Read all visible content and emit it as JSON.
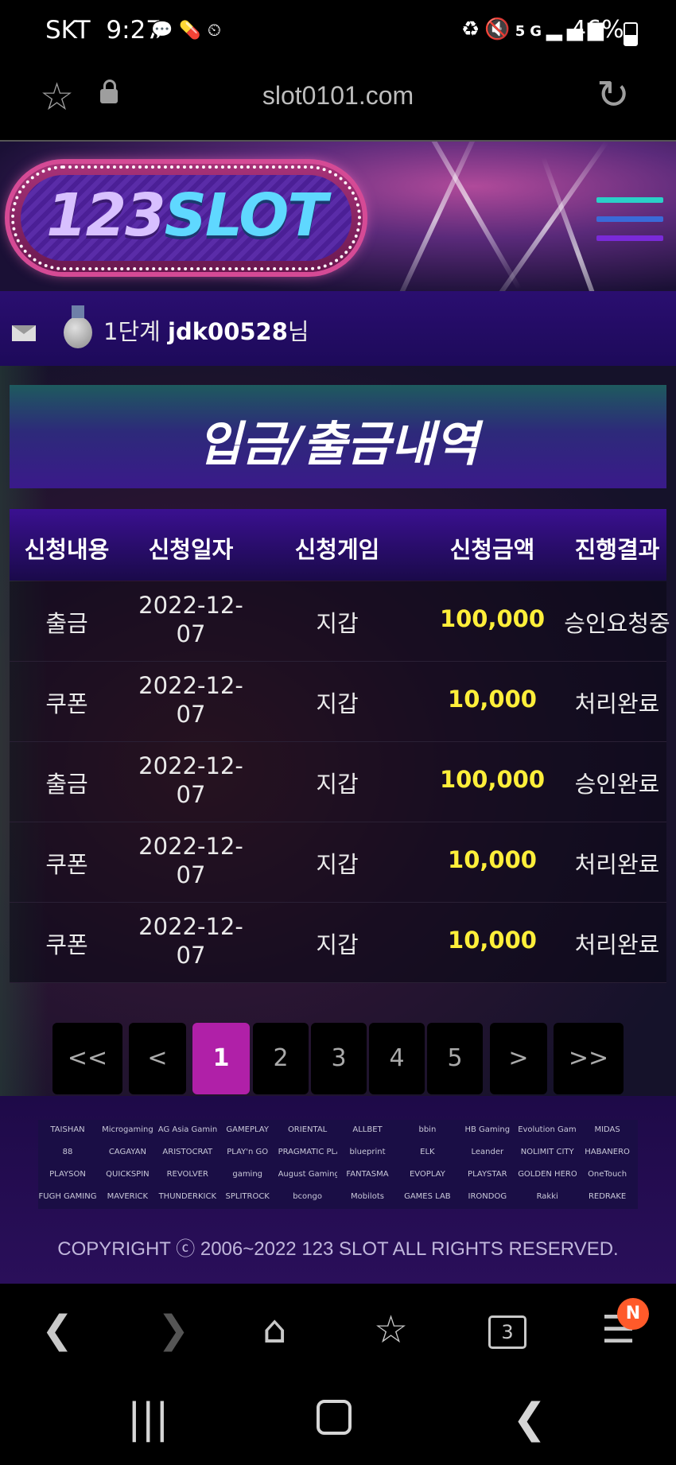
{
  "status_bar": {
    "carrier": "SKT",
    "time": "9:27",
    "left_icons": [
      "talk-icon",
      "pill-icon",
      "timer-icon"
    ],
    "right_icons": [
      "recycle-battery-icon",
      "mute-icon",
      "5g-icon",
      "signal-icon"
    ],
    "battery": "46%"
  },
  "browser": {
    "url": "slot0101.com",
    "toolbar_icons": [
      "back-icon",
      "forward-icon",
      "home-icon",
      "bookmarks-icon",
      "tabs-icon",
      "menu-icon"
    ],
    "tab_count": "3",
    "menu_badge": "N"
  },
  "site": {
    "logo_number": "123",
    "logo_word": "SLOT",
    "user_level": "1단계",
    "username": "jdk00528",
    "user_suffix": "님",
    "page_title": "입금/출금내역"
  },
  "table": {
    "headers": [
      "신청내용",
      "신청일자",
      "신청게임",
      "신청금액",
      "진행결과"
    ],
    "rows": [
      {
        "type": "출금",
        "date_line1": "2022-12-",
        "date_line2": "07",
        "game": "지갑",
        "amount": "100,000",
        "result": "승인요청중"
      },
      {
        "type": "쿠폰",
        "date_line1": "2022-12-",
        "date_line2": "07",
        "game": "지갑",
        "amount": "10,000",
        "result": "처리완료"
      },
      {
        "type": "출금",
        "date_line1": "2022-12-",
        "date_line2": "07",
        "game": "지갑",
        "amount": "100,000",
        "result": "승인완료"
      },
      {
        "type": "쿠폰",
        "date_line1": "2022-12-",
        "date_line2": "07",
        "game": "지갑",
        "amount": "10,000",
        "result": "처리완료"
      },
      {
        "type": "쿠폰",
        "date_line1": "2022-12-",
        "date_line2": "07",
        "game": "지갑",
        "amount": "10,000",
        "result": "처리완료"
      }
    ]
  },
  "pagination": {
    "first": "<<",
    "prev": "<",
    "pages": [
      "1",
      "2",
      "3",
      "4",
      "5"
    ],
    "current": "1",
    "next": ">",
    "last": ">>"
  },
  "footer": {
    "partners": [
      "TAISHAN",
      "Microgaming",
      "AG Asia Gaming",
      "GAMEPLAY",
      "ORIENTAL",
      "ALLBET",
      "bbin",
      "HB Gaming",
      "Evolution Gaming",
      "MIDAS",
      "88",
      "CAGAYAN",
      "ARISTOCRAT",
      "PLAY'n GO",
      "PRAGMATIC PLAY",
      "blueprint",
      "ELK",
      "Leander",
      "NOLIMIT CITY",
      "HABANERO",
      "PLAYSON",
      "QUICKSPIN",
      "REVOLVER",
      "gaming",
      "August Gaming",
      "FANTASMA",
      "EVOPLAY",
      "PLAYSTAR",
      "GOLDEN HERO",
      "OneTouch",
      "FUGH GAMING",
      "MAVERICK",
      "THUNDERKICK",
      "SPLITROCK",
      "bcongo",
      "Mobilots",
      "GAMES LAB",
      "IRONDOG",
      "Rakki",
      "REDRAKE"
    ],
    "copyright": "COPYRIGHT ⓒ 2006~2022 123 SLOT ALL RIGHTS RESERVED."
  },
  "colors": {
    "amount": "#ffef3a",
    "active_page": "#b020a8",
    "header_bg": "#2a0e70",
    "badge": "#ff5a2a"
  }
}
